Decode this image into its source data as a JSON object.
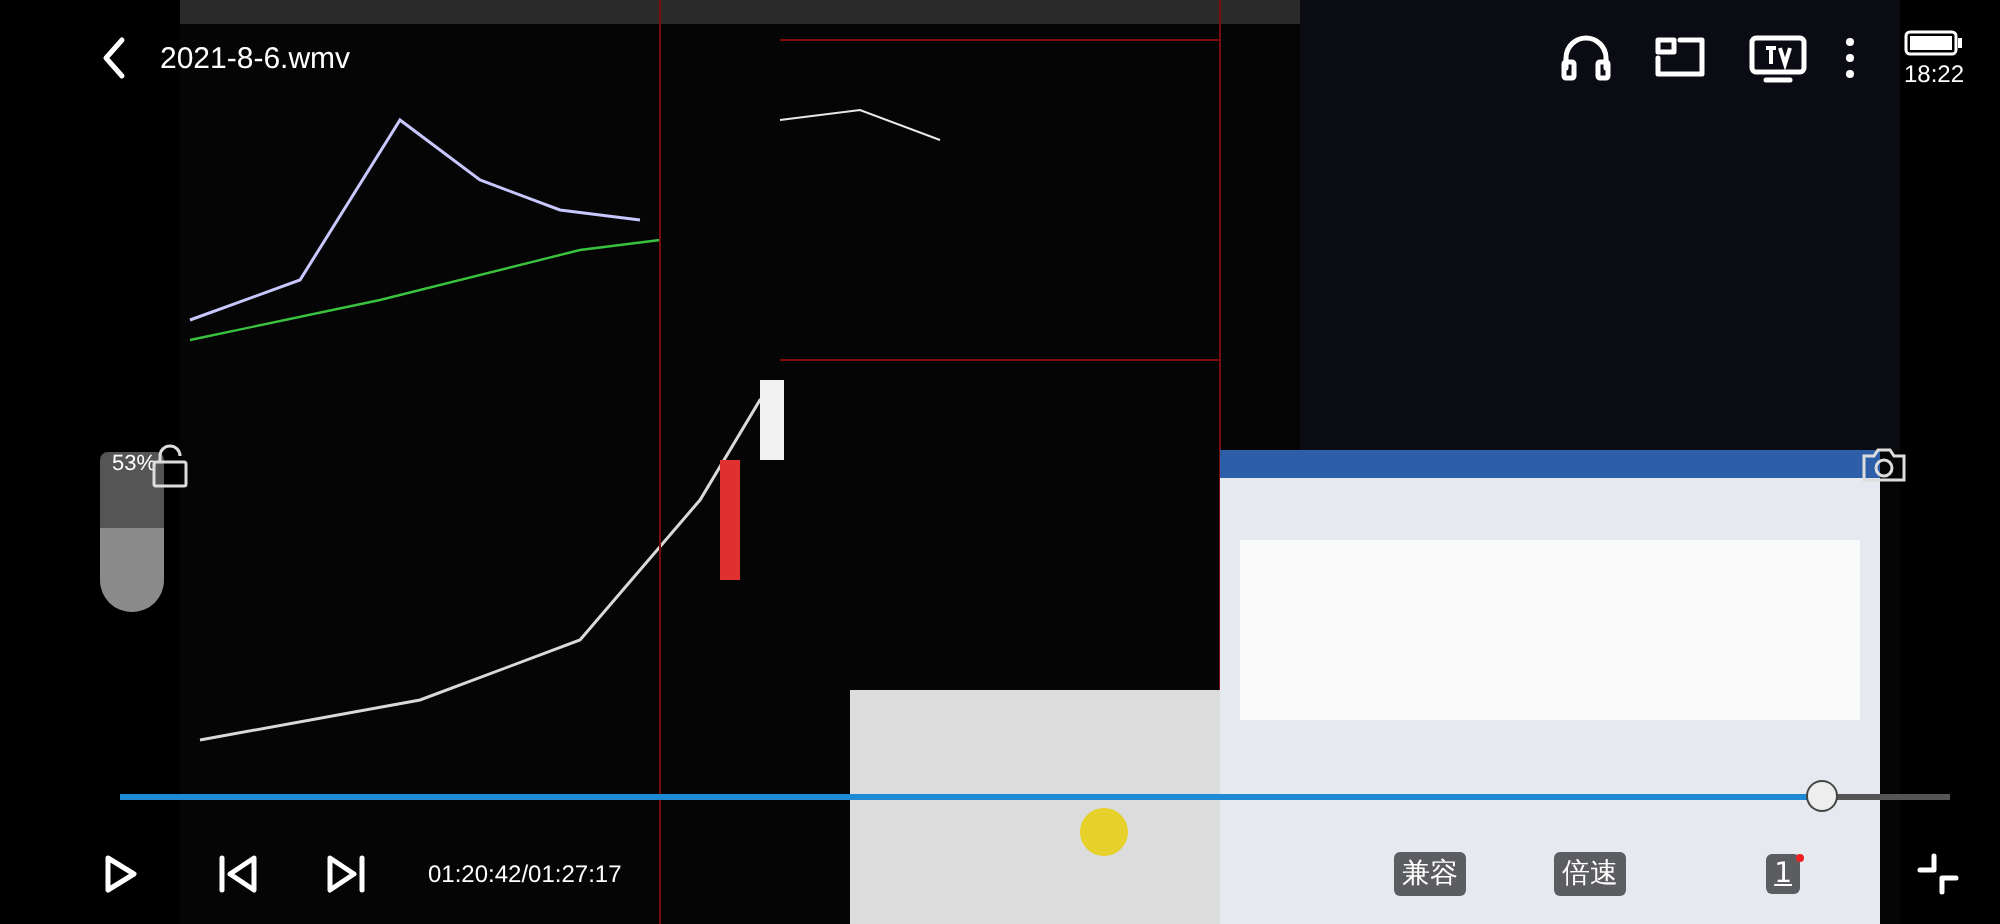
{
  "top_bar": {
    "title": "2021-8-6.wmv",
    "clock": "18:22"
  },
  "volume": {
    "reading": "53%",
    "level": 0.53
  },
  "progress": {
    "level": 0.93
  },
  "controls": {
    "time": "01:20:42/01:27:17",
    "compat_button": "兼容",
    "speed_button": "倍速",
    "episode_button": "1"
  }
}
